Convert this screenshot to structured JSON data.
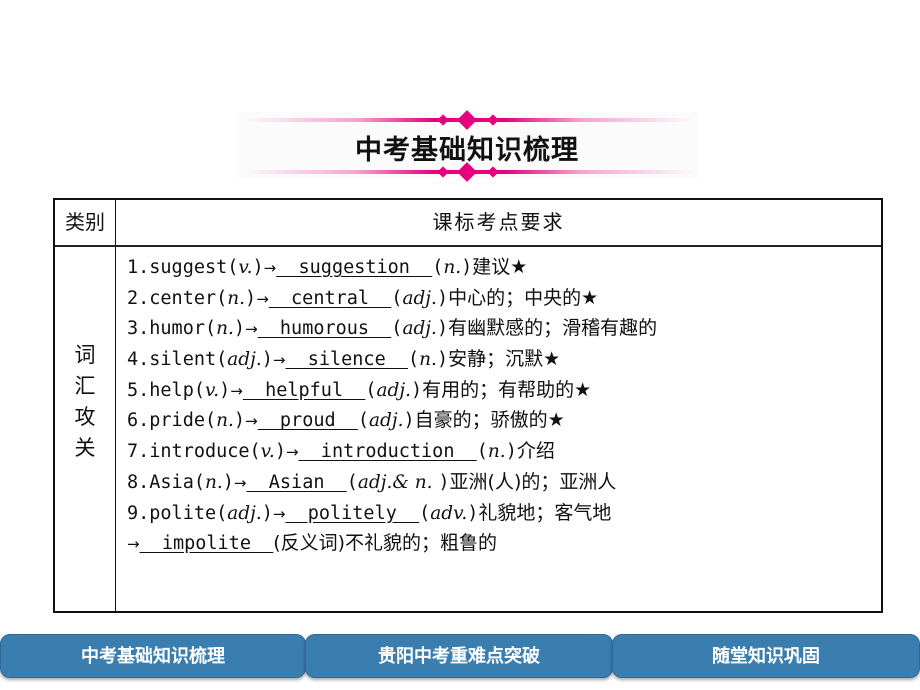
{
  "banner": {
    "title": "中考基础知识梳理",
    "accent_color": "#e6007e"
  },
  "table": {
    "header": {
      "category": "类别",
      "requirements": "课标考点要求"
    },
    "category_label": [
      "词",
      "汇",
      "攻",
      "关"
    ],
    "items": [
      {
        "num": "1.",
        "word": "suggest",
        "pos": "v.",
        "answer": "  suggestion  ",
        "answer_pos": "n.",
        "meaning": "建议★"
      },
      {
        "num": "2.",
        "word": "center",
        "pos": "n.",
        "answer": "  central  ",
        "answer_pos": "adj.",
        "meaning": "中心的；中央的★"
      },
      {
        "num": "3.",
        "word": "humor",
        "pos": "n.",
        "answer": "  humorous  ",
        "answer_pos": "adj.",
        "meaning": "有幽默感的；滑稽有趣的"
      },
      {
        "num": "4.",
        "word": "silent",
        "pos": "adj.",
        "answer": "  silence  ",
        "answer_pos": "n.",
        "meaning": "安静；沉默★"
      },
      {
        "num": "5.",
        "word": "help",
        "pos": "v.",
        "answer": "  helpful  ",
        "answer_pos": "adj.",
        "meaning": "有用的；有帮助的★"
      },
      {
        "num": "6.",
        "word": "pride",
        "pos": "n.",
        "answer": "  proud  ",
        "answer_pos": "adj.",
        "meaning": "自豪的；骄傲的★"
      },
      {
        "num": "7.",
        "word": "introduce",
        "pos": "v.",
        "answer": "  introduction  ",
        "answer_pos": "n.",
        "meaning": "介绍"
      },
      {
        "num": "8.",
        "word": "Asia",
        "pos": "n.",
        "answer": "  Asian  ",
        "answer_pos": "adj.& n. ",
        "meaning": "亚洲(人)的；亚洲人"
      },
      {
        "num": "9.",
        "word": "polite",
        "pos": "adj.",
        "answer": "  politely  ",
        "answer_pos": "adv.",
        "meaning": "礼貌地；客气地"
      }
    ],
    "extra_line": {
      "answer": "  impolite  ",
      "note": "(反义词)不礼貌的；粗鲁的"
    }
  },
  "bottom_nav": {
    "color": "#3a7eb0",
    "buttons": [
      {
        "label": "中考基础知识梳理"
      },
      {
        "label": "贵阳中考重难点突破"
      },
      {
        "label": "随堂知识巩固"
      }
    ]
  }
}
